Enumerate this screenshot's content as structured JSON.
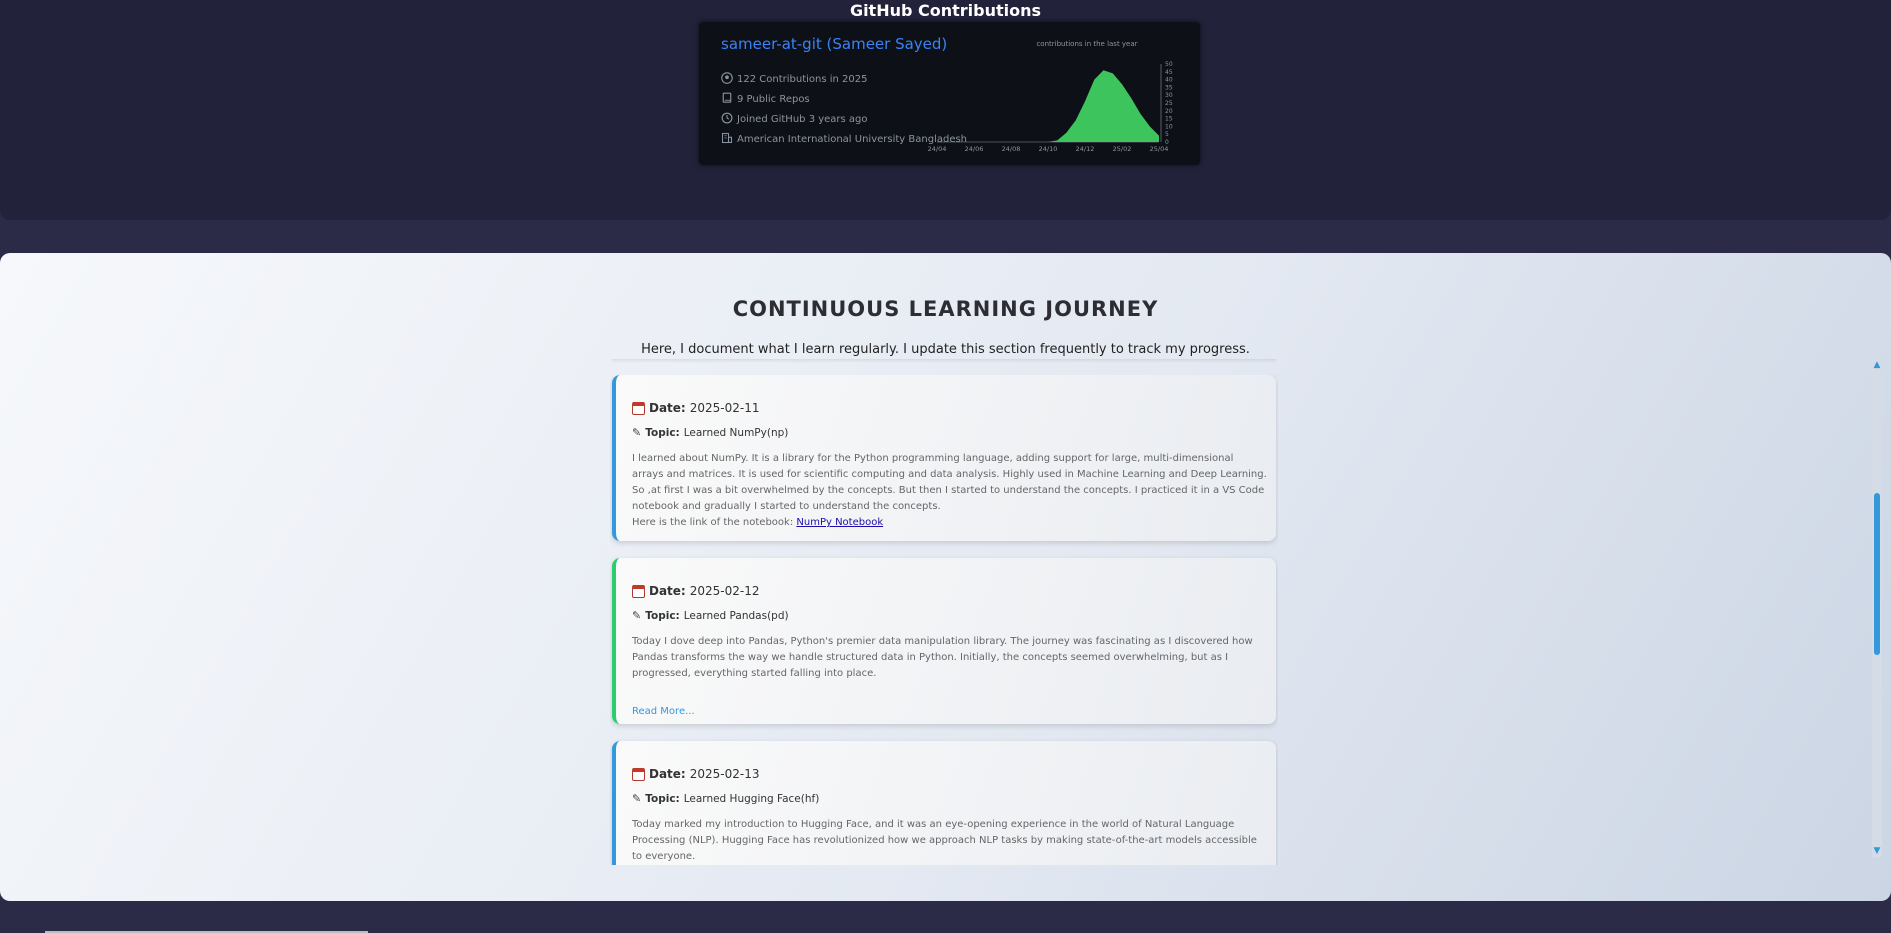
{
  "github": {
    "title": "GitHub Contributions",
    "username": "sameer-at-git (Sameer Sayed)",
    "contributions": "122 Contributions in 2025",
    "repos": "9 Public Repos",
    "joined": "Joined GitHub 3 years ago",
    "org": "American International University Bangladesh",
    "chart_label": "contributions in the last year"
  },
  "chart_data": {
    "type": "area",
    "title": "contributions in the last year",
    "x_ticks": [
      "24/04",
      "24/06",
      "24/08",
      "24/10",
      "24/12",
      "25/02",
      "25/04"
    ],
    "y_ticks": [
      0,
      5,
      10,
      15,
      20,
      25,
      30,
      35,
      40,
      45,
      50
    ],
    "ylim": [
      0,
      50
    ],
    "x": [
      0,
      0.5,
      1,
      1.5,
      2,
      2.5,
      3,
      3.25,
      3.5,
      3.75,
      4,
      4.25,
      4.5,
      4.75,
      5,
      5.25,
      5.5,
      5.75,
      6
    ],
    "values": [
      0,
      0,
      0,
      0,
      0,
      0,
      0,
      1,
      6,
      14,
      26,
      40,
      46,
      44,
      37,
      28,
      18,
      10,
      4
    ],
    "color": "#3ec45c",
    "legend": "none",
    "grid": false
  },
  "learning": {
    "title": "CONTINUOUS LEARNING JOURNEY",
    "subtitle": "Here, I document what I learn regularly. I update this section frequently to track my progress.",
    "date_label": "Date:",
    "topic_label": "Topic:",
    "entries": [
      {
        "date": "2025-02-11",
        "topic": "Learned NumPy(np)",
        "description": "I learned about NumPy. It is a library for the Python programming language, adding support for large, multi-dimensional arrays and matrices. It is used for scientific computing and data analysis. Highly used in Machine Learning and Deep Learning. So ,at first I was a bit overwhelmed by the concepts. But then I started to understand the concepts. I practiced it in a VS Code notebook and gradually I started to understand the concepts.",
        "link_prefix": "Here is the link of the notebook:",
        "link_text": "NumPy Notebook",
        "accent": "#3498db"
      },
      {
        "date": "2025-02-12",
        "topic": "Learned Pandas(pd)",
        "description": "Today I dove deep into Pandas, Python's premier data manipulation library. The journey was fascinating as I discovered how Pandas transforms the way we handle structured data in Python. Initially, the concepts seemed overwhelming, but as I progressed, everything started falling into place.",
        "read_more": "Read More...",
        "accent": "#2ecc71"
      },
      {
        "date": "2025-02-13",
        "topic": "Learned Hugging Face(hf)",
        "description": "Today marked my introduction to Hugging Face, and it was an eye-opening experience in the world of Natural Language Processing (NLP). Hugging Face has revolutionized how we approach NLP tasks by making state-of-the-art models accessible to everyone.",
        "accent": "#3498db"
      }
    ]
  }
}
